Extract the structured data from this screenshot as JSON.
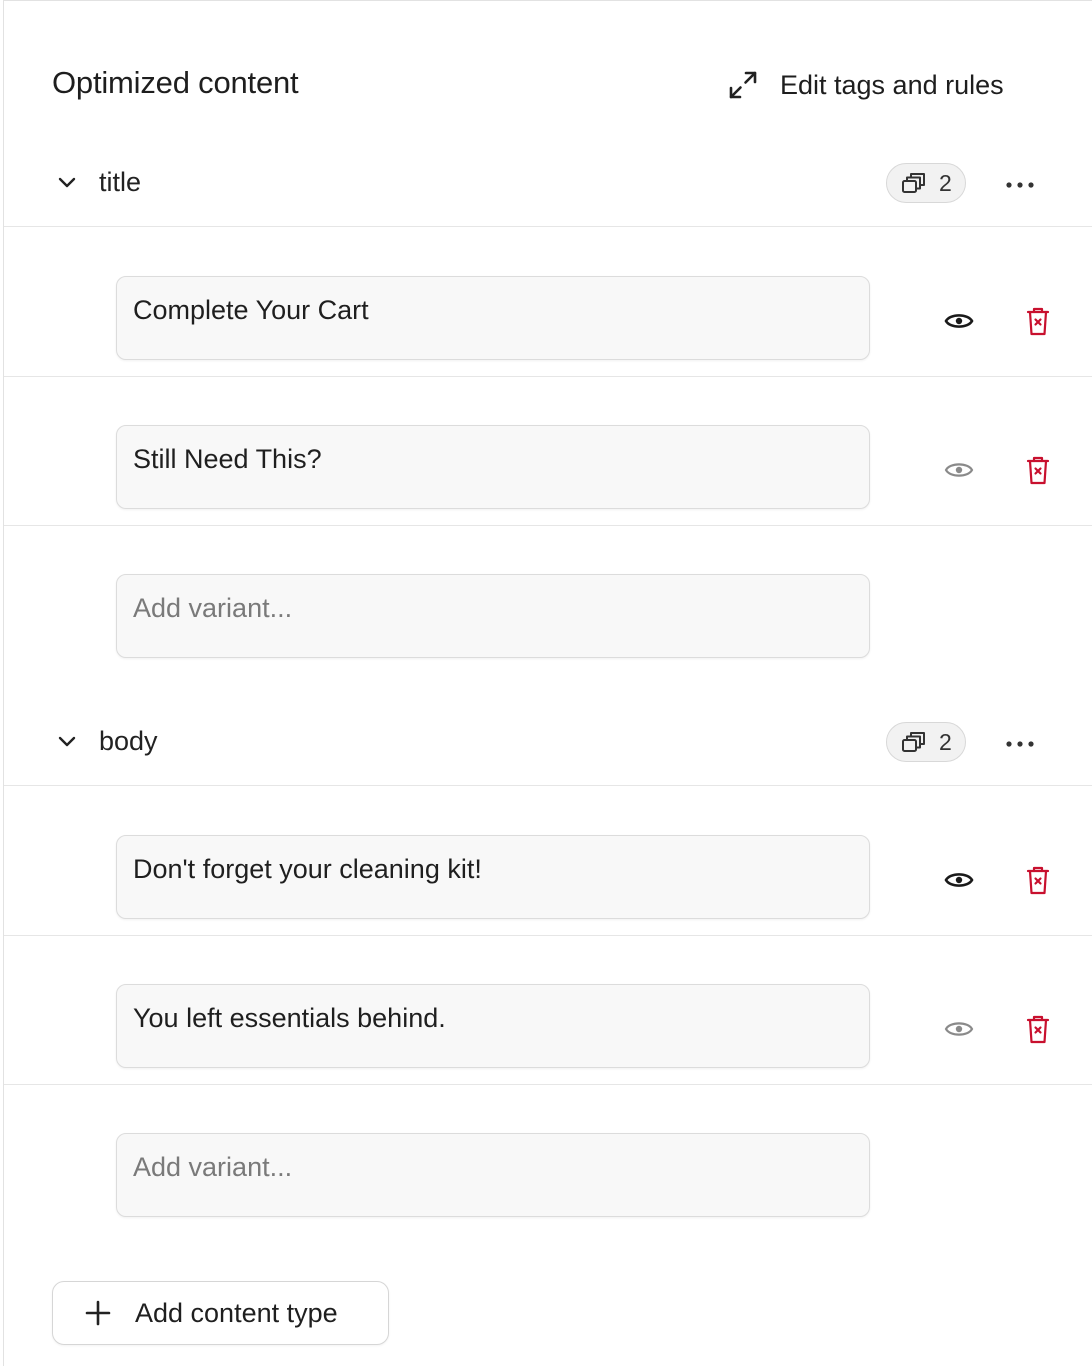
{
  "header": {
    "title": "Optimized content",
    "edit_link_label": "Edit tags and rules",
    "edit_link_icon": "expand-arrows-icon"
  },
  "sections": [
    {
      "name": "title",
      "count": "2",
      "variants": [
        {
          "text": "Complete Your Cart",
          "visible": true
        },
        {
          "text": "Still Need This?",
          "visible": false
        }
      ],
      "add_placeholder": "Add variant..."
    },
    {
      "name": "body",
      "count": "2",
      "variants": [
        {
          "text": "Don't forget your cleaning kit!",
          "visible": true
        },
        {
          "text": "You left essentials behind.",
          "visible": false
        }
      ],
      "add_placeholder": "Add variant..."
    }
  ],
  "footer": {
    "add_content_type_label": "Add content type"
  },
  "colors": {
    "delete_red": "#c8102e",
    "eye_active": "#1a1a1a",
    "eye_inactive": "#8a8a8a"
  }
}
